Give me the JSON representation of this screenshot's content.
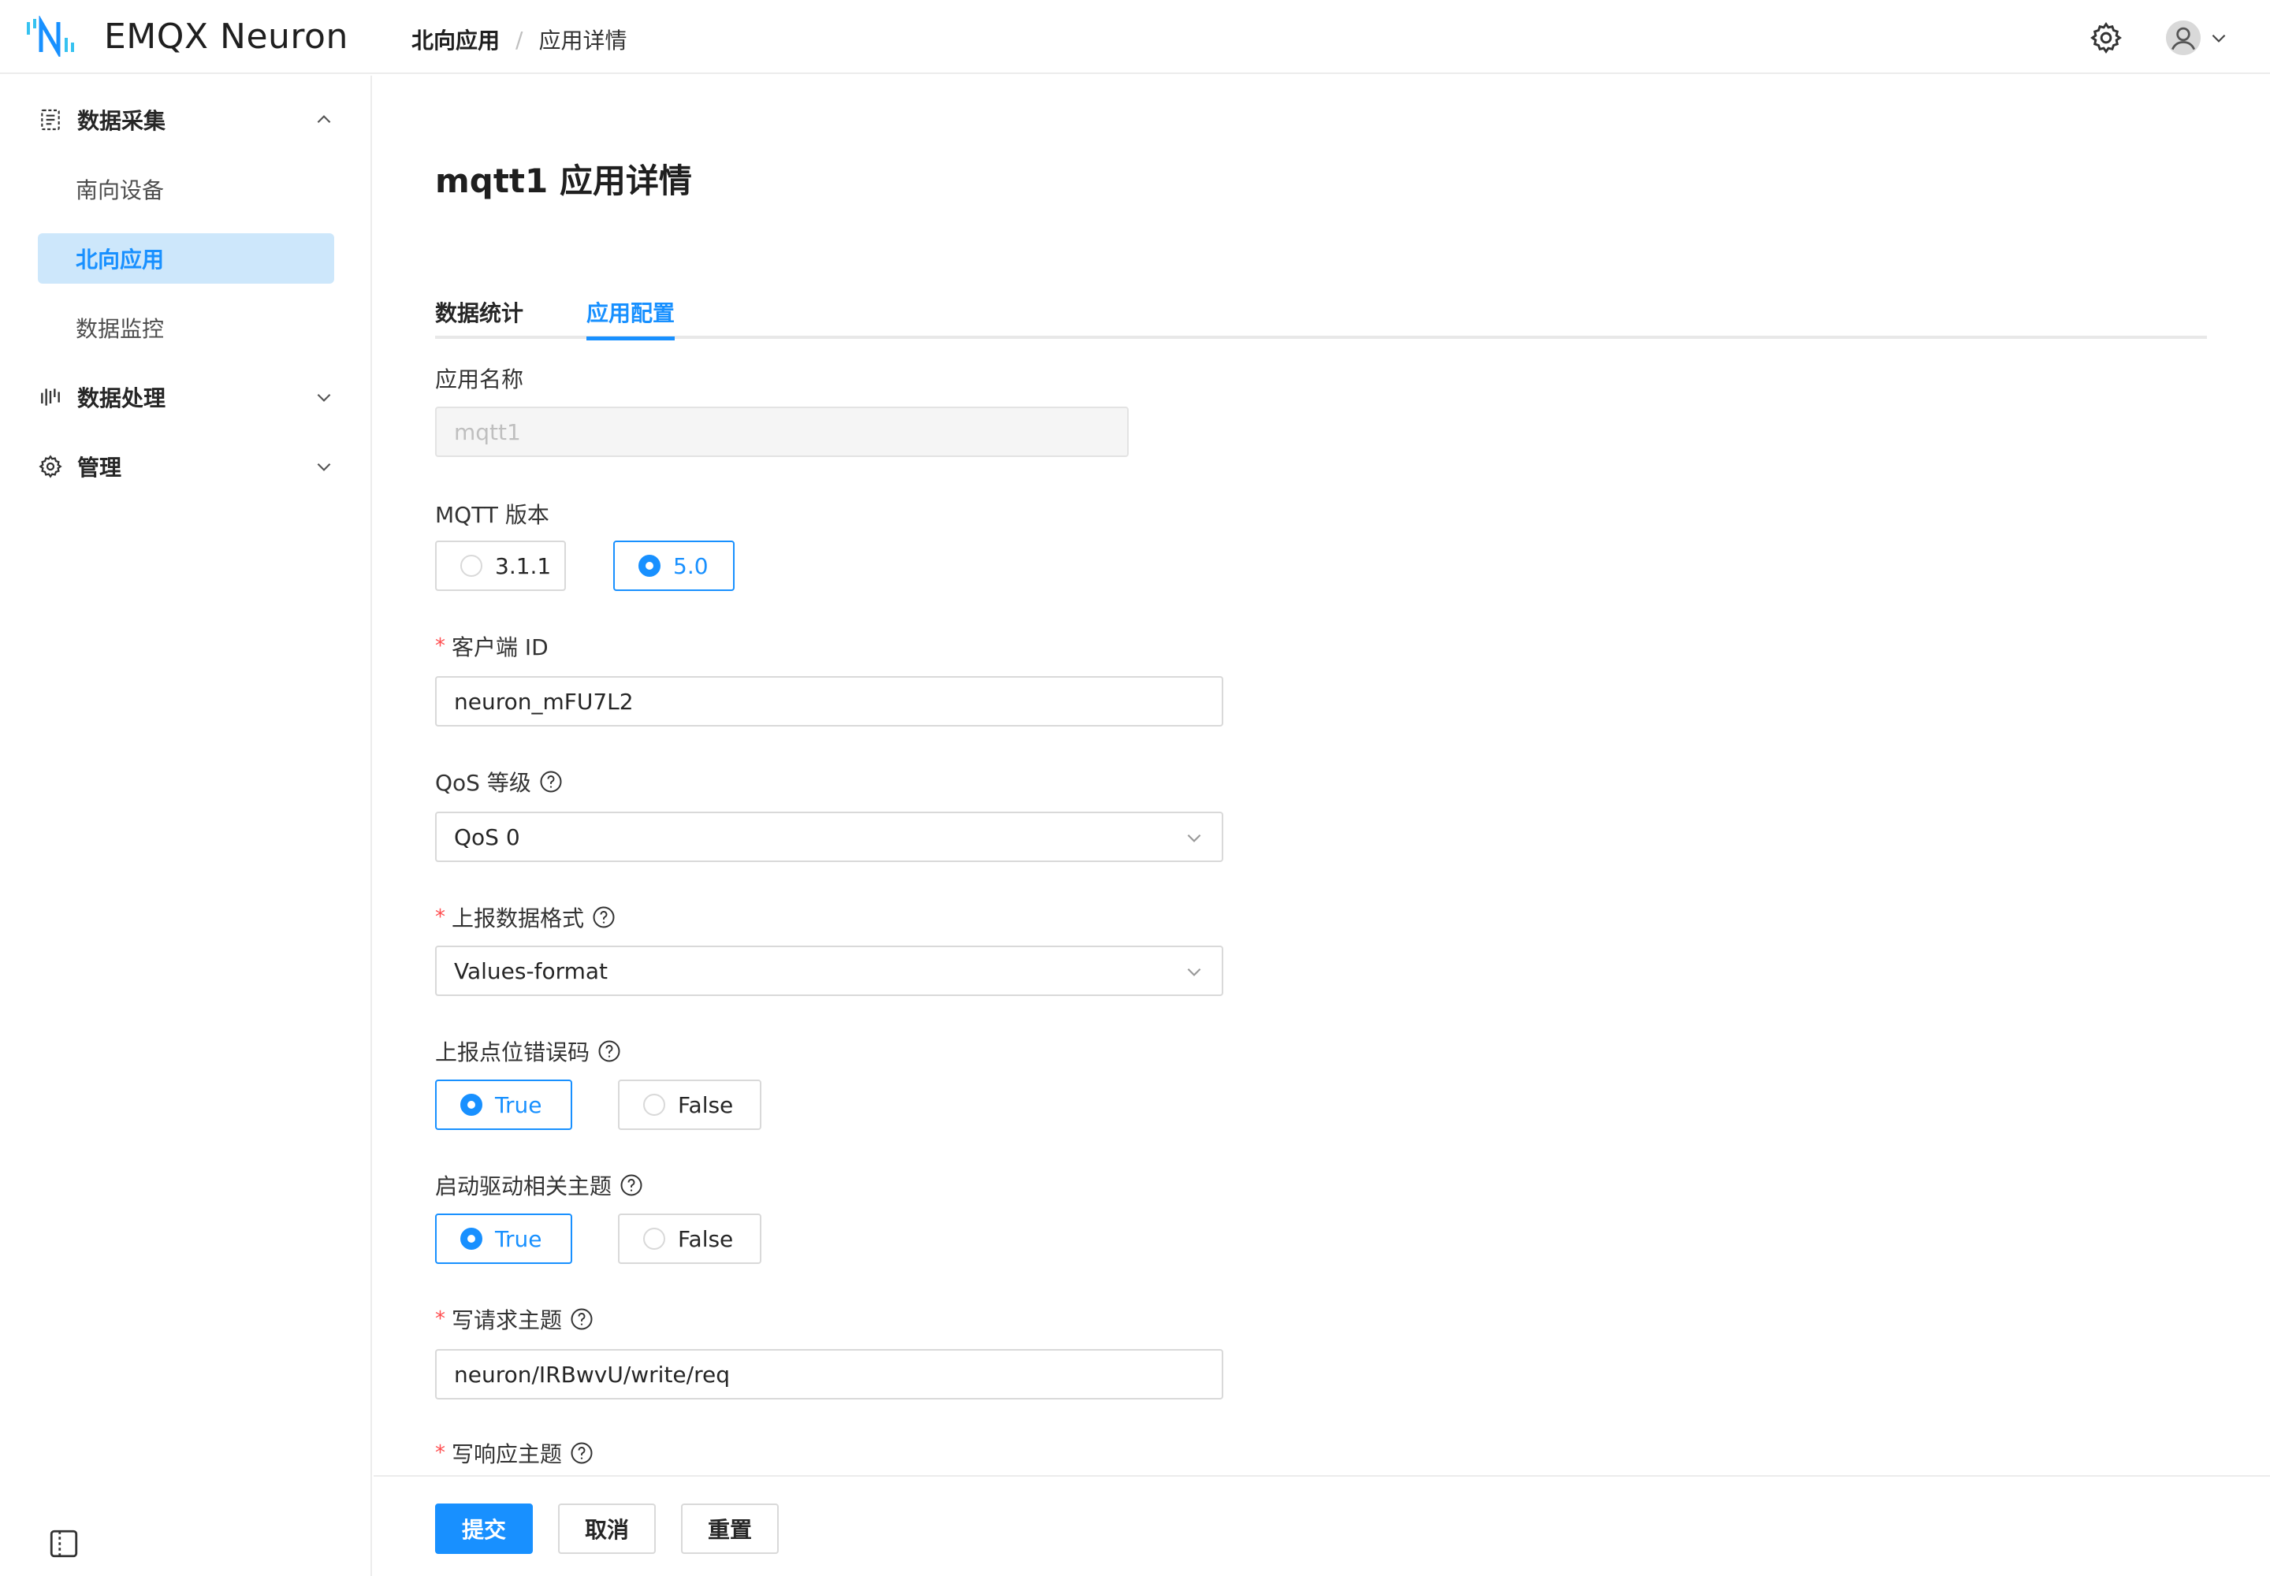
{
  "header": {
    "brand": "EMQX Neuron",
    "breadcrumb_parent": "北向应用",
    "breadcrumb_sep": "/",
    "breadcrumb_current": "应用详情"
  },
  "sidebar": {
    "groups": [
      {
        "label": "数据采集",
        "expanded": true,
        "icon": "data-collection-icon",
        "items": [
          {
            "label": "南向设备",
            "active": false
          },
          {
            "label": "北向应用",
            "active": true
          },
          {
            "label": "数据监控",
            "active": false
          }
        ]
      },
      {
        "label": "数据处理",
        "expanded": false,
        "icon": "data-processing-icon"
      },
      {
        "label": "管理",
        "expanded": false,
        "icon": "gear-icon"
      }
    ]
  },
  "page": {
    "title": "mqtt1 应用详情",
    "tabs": [
      {
        "label": "数据统计",
        "active": false
      },
      {
        "label": "应用配置",
        "active": true
      }
    ]
  },
  "form": {
    "app_name": {
      "label": "应用名称",
      "value": "mqtt1",
      "disabled": true
    },
    "mqtt_version": {
      "label": "MQTT 版本",
      "options": [
        "3.1.1",
        "5.0"
      ],
      "selected": "5.0"
    },
    "client_id": {
      "label": "客户端 ID",
      "required": "*",
      "value": "neuron_mFU7L2"
    },
    "qos": {
      "label": "QoS 等级",
      "value": "QoS 0"
    },
    "report_format": {
      "label": "上报数据格式",
      "required": "*",
      "value": "Values-format"
    },
    "report_error_code": {
      "label": "上报点位错误码",
      "options": [
        "True",
        "False"
      ],
      "selected": "True"
    },
    "driver_topics": {
      "label": "启动驱动相关主题",
      "options": [
        "True",
        "False"
      ],
      "selected": "True"
    },
    "write_req_topic": {
      "label": "写请求主题",
      "required": "*",
      "value": "neuron/IRBwvU/write/req"
    },
    "write_resp_topic": {
      "label": "写响应主题",
      "required": "*"
    }
  },
  "footer": {
    "submit": "提交",
    "cancel": "取消",
    "reset": "重置"
  },
  "colors": {
    "primary": "#1890ff",
    "active_bg": "#cde7fb",
    "required": "#ff4d4f"
  }
}
